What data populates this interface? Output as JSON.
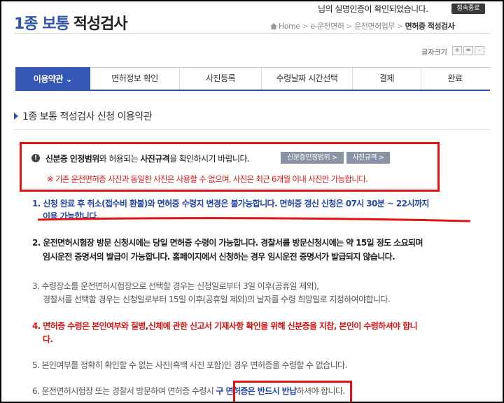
{
  "header": {
    "title_accent": "1종 보통",
    "title_rest": "적성검사",
    "auth_message": "님의 실명인증이 확인되었습니다.",
    "logout_label": "접속종료",
    "breadcrumb": [
      "Home",
      "e-운전면허",
      "운전면허업무",
      "면허증 적성검사"
    ]
  },
  "font_size": {
    "label": "글자크기",
    "plus": "+",
    "reset": "=",
    "minus": "-"
  },
  "tabs": [
    "이용약관 ⌄",
    "면허정보 확인",
    "사진등록",
    "수령날짜 시간선택",
    "결제",
    "완료"
  ],
  "section_title": "1종 보통 적성검사 신청 이용약관",
  "notice": {
    "text_strong": "신분증 인정범위",
    "text_mid": "와 허용되는 ",
    "text_strong2": "사진규격",
    "text_end": "을 확인하시기 바랍니다.",
    "btn1": "신분증인정범위 >",
    "btn2": "사진규격 >",
    "warning": "※ 기존 운전면허증 사진과 동일한 사진은 사용할 수 없으며, 사진은 최근 6개월 이내 사진만 가능합니다."
  },
  "items": {
    "i1_l1": "1.  신청 완료 후 취소(접수비 환불)와 면허증 수령지 변경은 불가능합니다. 면허증 갱신 신청은 07시 30분 ~ 22시까지",
    "i1_l2": "이용 가능합니다.",
    "i2_l1": "2.  운전면허시험장 방문 신청시에는 당일 면허증 수령이 가능합니다. 경찰서를 방문신청시에는 약 15일 정도 소요되며",
    "i2_l2": "임시운전 증명서의 발급이 가능합니다. 홈페이지에서 신청하는 경우 임시운전 증명서가 발급되지 않습니다.",
    "i3_l1": "3.  수령장소를 운전면허시험장으로 선택할 경우는 신청일로부터 3일 이후(공휴일 제외),",
    "i3_l2": "경찰서를 선택할 경우는 신청일로부터 15일 이후(공휴일 제외)의 날자를 수령 희망일로 지정하여야합니다.",
    "i4_l1": "4.  면허증 수령은 본인여부와 질병,신체에 관한 신고서 기재사항 확인을 위해 신분증을 지참, 본인이 수령하셔야 합니",
    "i4_l2": "다.",
    "i5": "5.  본인여부를 정확히 확인할 수 없는 사진(흑백 사진 포함)인 경우 면허증을 수령할 수 없습니다.",
    "i6_pre": "6.  운전면허시험장 또는 경찰서 방문하여 면허증 수령시 ",
    "i6_blue": "구 면허증은 반드시 반납",
    "i6_post": "하셔야 합니다."
  },
  "colors": {
    "brand_blue": "#2d54b0",
    "active_tab": "#3656b6",
    "highlight_red": "#e21313"
  }
}
